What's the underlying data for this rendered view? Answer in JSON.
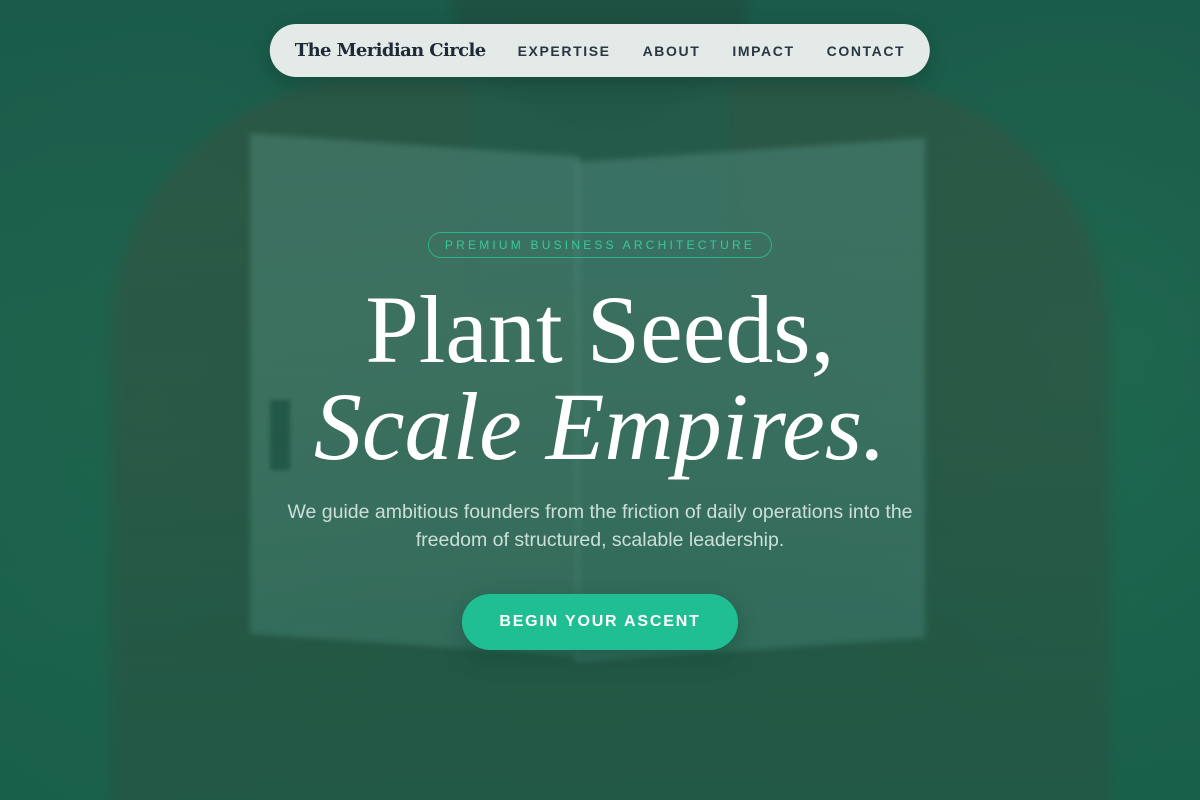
{
  "nav": {
    "brand": "The Meridian Circle",
    "links": [
      "EXPERTISE",
      "ABOUT",
      "IMPACT",
      "CONTACT"
    ]
  },
  "hero": {
    "eyebrow": "PREMIUM BUSINESS ARCHITECTURE",
    "headline_line1": "Plant Seeds,",
    "headline_line2": "Scale Empires.",
    "subtext": "We guide ambitious founders from the friction of daily operations into the freedom of structured, scalable leadership.",
    "cta_label": "BEGIN YOUR ASCENT",
    "background_image": "person-reading-book-photo"
  },
  "colors": {
    "accent": "#1fbf93",
    "overlay": "#1c5c4a",
    "nav_bg": "#f4f6f5",
    "brand_text": "#1f2a36"
  }
}
